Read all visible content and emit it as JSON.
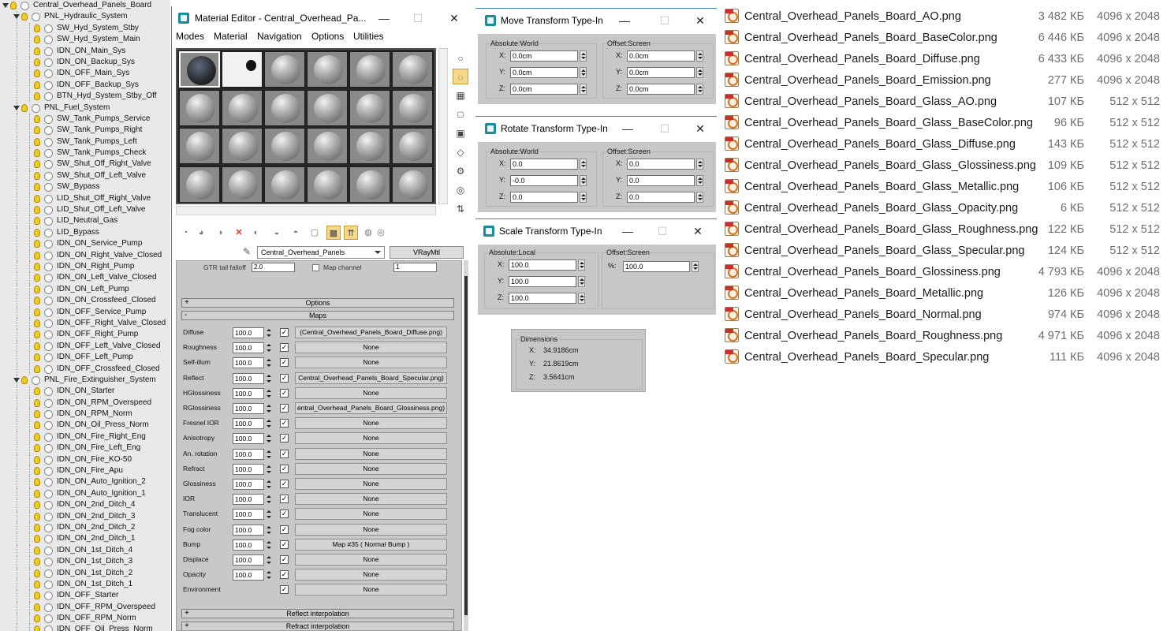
{
  "explorer": {
    "rows": [
      {
        "label": "Central_Overhead_Panels_Board",
        "depth": 0,
        "expandable": true
      },
      {
        "label": "PNL_Hydraulic_System",
        "depth": 1,
        "expandable": true
      },
      {
        "label": "SW_Hyd_System_Stby",
        "depth": 2,
        "expandable": false
      },
      {
        "label": "SW_Hyd_System_Main",
        "depth": 2,
        "expandable": false
      },
      {
        "label": "IDN_ON_Main_Sys",
        "depth": 2,
        "expandable": false
      },
      {
        "label": "IDN_ON_Backup_Sys",
        "depth": 2,
        "expandable": false
      },
      {
        "label": "IDN_OFF_Main_Sys",
        "depth": 2,
        "expandable": false
      },
      {
        "label": "IDN_OFF_Backup_Sys",
        "depth": 2,
        "expandable": false
      },
      {
        "label": "BTN_Hyd_System_Stby_Off",
        "depth": 2,
        "expandable": false
      },
      {
        "label": "PNL_Fuel_System",
        "depth": 1,
        "expandable": true
      },
      {
        "label": "SW_Tank_Pumps_Service",
        "depth": 2,
        "expandable": false
      },
      {
        "label": "SW_Tank_Pumps_Right",
        "depth": 2,
        "expandable": false
      },
      {
        "label": "SW_Tank_Pumps_Left",
        "depth": 2,
        "expandable": false
      },
      {
        "label": "SW_Tank_Pumps_Check",
        "depth": 2,
        "expandable": false
      },
      {
        "label": "SW_Shut_Off_Right_Valve",
        "depth": 2,
        "expandable": false
      },
      {
        "label": "SW_Shut_Off_Left_Valve",
        "depth": 2,
        "expandable": false
      },
      {
        "label": "SW_Bypass",
        "depth": 2,
        "expandable": false
      },
      {
        "label": "LID_Shut_Off_Right_Valve",
        "depth": 2,
        "expandable": false
      },
      {
        "label": "LID_Shut_Off_Left_Valve",
        "depth": 2,
        "expandable": false
      },
      {
        "label": "LID_Neutral_Gas",
        "depth": 2,
        "expandable": false
      },
      {
        "label": "LID_Bypass",
        "depth": 2,
        "expandable": false
      },
      {
        "label": "IDN_ON_Service_Pump",
        "depth": 2,
        "expandable": false
      },
      {
        "label": "IDN_ON_Right_Valve_Closed",
        "depth": 2,
        "expandable": false
      },
      {
        "label": "IDN_ON_Right_Pump",
        "depth": 2,
        "expandable": false
      },
      {
        "label": "IDN_ON_Left_Valve_Closed",
        "depth": 2,
        "expandable": false
      },
      {
        "label": "IDN_ON_Left_Pump",
        "depth": 2,
        "expandable": false
      },
      {
        "label": "IDN_ON_Crossfeed_Closed",
        "depth": 2,
        "expandable": false
      },
      {
        "label": "IDN_OFF_Service_Pump",
        "depth": 2,
        "expandable": false
      },
      {
        "label": "IDN_OFF_Right_Valve_Closed",
        "depth": 2,
        "expandable": false
      },
      {
        "label": "IDN_OFF_Right_Pump",
        "depth": 2,
        "expandable": false
      },
      {
        "label": "IDN_OFF_Left_Valve_Closed",
        "depth": 2,
        "expandable": false
      },
      {
        "label": "IDN_OFF_Left_Pump",
        "depth": 2,
        "expandable": false
      },
      {
        "label": "IDN_OFF_Crossfeed_Closed",
        "depth": 2,
        "expandable": false
      },
      {
        "label": "PNL_Fire_Extinguisher_System",
        "depth": 1,
        "expandable": true
      },
      {
        "label": "IDN_ON_Starter",
        "depth": 2,
        "expandable": false
      },
      {
        "label": "IDN_ON_RPM_Overspeed",
        "depth": 2,
        "expandable": false
      },
      {
        "label": "IDN_ON_RPM_Norm",
        "depth": 2,
        "expandable": false
      },
      {
        "label": "IDN_ON_Oil_Press_Norm",
        "depth": 2,
        "expandable": false
      },
      {
        "label": "IDN_ON_Fire_Right_Eng",
        "depth": 2,
        "expandable": false
      },
      {
        "label": "IDN_ON_Fire_Left_Eng",
        "depth": 2,
        "expandable": false
      },
      {
        "label": "IDN_ON_Fire_KO-50",
        "depth": 2,
        "expandable": false
      },
      {
        "label": "IDN_ON_Fire_Apu",
        "depth": 2,
        "expandable": false
      },
      {
        "label": "IDN_ON_Auto_Ignition_2",
        "depth": 2,
        "expandable": false
      },
      {
        "label": "IDN_ON_Auto_Ignition_1",
        "depth": 2,
        "expandable": false
      },
      {
        "label": "IDN_ON_2nd_Ditch_4",
        "depth": 2,
        "expandable": false
      },
      {
        "label": "IDN_ON_2nd_Ditch_3",
        "depth": 2,
        "expandable": false
      },
      {
        "label": "IDN_ON_2nd_Ditch_2",
        "depth": 2,
        "expandable": false
      },
      {
        "label": "IDN_ON_2nd_Ditch_1",
        "depth": 2,
        "expandable": false
      },
      {
        "label": "IDN_ON_1st_Ditch_4",
        "depth": 2,
        "expandable": false
      },
      {
        "label": "IDN_ON_1st_Ditch_3",
        "depth": 2,
        "expandable": false
      },
      {
        "label": "IDN_ON_1st_Ditch_2",
        "depth": 2,
        "expandable": false
      },
      {
        "label": "IDN_ON_1st_Ditch_1",
        "depth": 2,
        "expandable": false
      },
      {
        "label": "IDN_OFF_Starter",
        "depth": 2,
        "expandable": false
      },
      {
        "label": "IDN_OFF_RPM_Overspeed",
        "depth": 2,
        "expandable": false
      },
      {
        "label": "IDN_OFF_RPM_Norm",
        "depth": 2,
        "expandable": false
      },
      {
        "label": "IDN_OFF_Oil_Press_Norm",
        "depth": 2,
        "expandable": false
      }
    ]
  },
  "material_editor": {
    "title": "Material Editor - Central_Overhead_Pa...",
    "menu": [
      "Modes",
      "Material",
      "Navigation",
      "Options",
      "Utilities"
    ],
    "material_name": "Central_Overhead_Panels",
    "material_type": "VRayMtl",
    "partial_row": {
      "label": "GTR tail falloff",
      "value": "2.0",
      "checkbox_label": "Map channel",
      "channel": "1"
    },
    "rollouts": {
      "options": {
        "sign": "+",
        "label": "Options"
      },
      "maps": {
        "sign": "-",
        "label": "Maps"
      },
      "reflect_interp": {
        "sign": "+",
        "label": "Reflect interpolation"
      },
      "refract_interp": {
        "sign": "+",
        "label": "Refract interpolation"
      }
    },
    "maps": [
      {
        "name": "Diffuse",
        "amount": "100.0",
        "checked": true,
        "map": "(Central_Overhead_Panels_Board_Diffuse.png)"
      },
      {
        "name": "Roughness",
        "amount": "100.0",
        "checked": true,
        "map": "None"
      },
      {
        "name": "Self-illum",
        "amount": "100.0",
        "checked": true,
        "map": "None"
      },
      {
        "name": "Reflect",
        "amount": "100.0",
        "checked": true,
        "map": "Central_Overhead_Panels_Board_Specular.png)"
      },
      {
        "name": "HGlossiness",
        "amount": "100.0",
        "checked": true,
        "map": "None"
      },
      {
        "name": "RGlossiness",
        "amount": "100.0",
        "checked": true,
        "map": "entral_Overhead_Panels_Board_Glossiness.png)"
      },
      {
        "name": "Fresnel IOR",
        "amount": "100.0",
        "checked": true,
        "map": "None"
      },
      {
        "name": "Anisotropy",
        "amount": "100.0",
        "checked": true,
        "map": "None"
      },
      {
        "name": "An. rotation",
        "amount": "100.0",
        "checked": true,
        "map": "None"
      },
      {
        "name": "Refract",
        "amount": "100.0",
        "checked": true,
        "map": "None"
      },
      {
        "name": "Glossiness",
        "amount": "100.0",
        "checked": true,
        "map": "None"
      },
      {
        "name": "IOR",
        "amount": "100.0",
        "checked": true,
        "map": "None"
      },
      {
        "name": "Translucent",
        "amount": "100.0",
        "checked": true,
        "map": "None"
      },
      {
        "name": "Fog color",
        "amount": "100.0",
        "checked": true,
        "map": "None"
      },
      {
        "name": "Bump",
        "amount": "100.0",
        "checked": true,
        "map": "Map #35  ( Normal Bump )"
      },
      {
        "name": "Displace",
        "amount": "100.0",
        "checked": true,
        "map": "None"
      },
      {
        "name": "Opacity",
        "amount": "100.0",
        "checked": true,
        "map": "None"
      },
      {
        "name": "Environment",
        "amount": "",
        "checked": true,
        "map": "None"
      }
    ],
    "check_glyph": "✓",
    "colors": {
      "title_border": "#3c7ed6",
      "panel_bg": "#c8c8c8",
      "slot_bg": "#262626",
      "active_tool": "#f7d88a"
    }
  },
  "move_dialog": {
    "title": "Move Transform Type-In",
    "left_group": "Absolute:World",
    "right_group": "Offset:Screen",
    "left": [
      {
        "axis": "X:",
        "value": "0.0cm"
      },
      {
        "axis": "Y:",
        "value": "0.0cm"
      },
      {
        "axis": "Z:",
        "value": "0.0cm"
      }
    ],
    "right": [
      {
        "axis": "X:",
        "value": "0.0cm"
      },
      {
        "axis": "Y:",
        "value": "0.0cm"
      },
      {
        "axis": "Z:",
        "value": "0.0cm"
      }
    ]
  },
  "rotate_dialog": {
    "title": "Rotate Transform Type-In",
    "left_group": "Absolute:World",
    "right_group": "Offset:Screen",
    "left": [
      {
        "axis": "X:",
        "value": "0.0"
      },
      {
        "axis": "Y:",
        "value": "-0.0"
      },
      {
        "axis": "Z:",
        "value": "0.0"
      }
    ],
    "right": [
      {
        "axis": "X:",
        "value": "0.0"
      },
      {
        "axis": "Y:",
        "value": "0.0"
      },
      {
        "axis": "Z:",
        "value": "0.0"
      }
    ]
  },
  "scale_dialog": {
    "title": "Scale Transform Type-In",
    "left_group": "Absolute:Local",
    "right_group": "Offset:Screen",
    "left": [
      {
        "axis": "X:",
        "value": "100.0"
      },
      {
        "axis": "Y:",
        "value": "100.0"
      },
      {
        "axis": "Z:",
        "value": "100.0"
      }
    ],
    "right": [
      {
        "axis": "%:",
        "value": "100.0"
      }
    ]
  },
  "dimensions": {
    "title": "Dimensions",
    "rows": [
      {
        "axis": "X:",
        "value": "34.9186cm"
      },
      {
        "axis": "Y:",
        "value": "21.8619cm"
      },
      {
        "axis": "Z:",
        "value": "3.5641cm"
      }
    ]
  },
  "window_buttons": {
    "minimize": "—",
    "maximize": "☐",
    "close": "✕"
  },
  "files": [
    {
      "name": "Central_Overhead_Panels_Board_AO.png",
      "size": "3 482 КБ",
      "dims": "4096 x 2048"
    },
    {
      "name": "Central_Overhead_Panels_Board_BaseColor.png",
      "size": "6 446 КБ",
      "dims": "4096 x 2048"
    },
    {
      "name": "Central_Overhead_Panels_Board_Diffuse.png",
      "size": "6 433 КБ",
      "dims": "4096 x 2048"
    },
    {
      "name": "Central_Overhead_Panels_Board_Emission.png",
      "size": "277 КБ",
      "dims": "4096 x 2048"
    },
    {
      "name": "Central_Overhead_Panels_Board_Glass_AO.png",
      "size": "107 КБ",
      "dims": "512 x 512"
    },
    {
      "name": "Central_Overhead_Panels_Board_Glass_BaseColor.png",
      "size": "96 КБ",
      "dims": "512 x 512"
    },
    {
      "name": "Central_Overhead_Panels_Board_Glass_Diffuse.png",
      "size": "143 КБ",
      "dims": "512 x 512"
    },
    {
      "name": "Central_Overhead_Panels_Board_Glass_Glossiness.png",
      "size": "109 КБ",
      "dims": "512 x 512"
    },
    {
      "name": "Central_Overhead_Panels_Board_Glass_Metallic.png",
      "size": "106 КБ",
      "dims": "512 x 512"
    },
    {
      "name": "Central_Overhead_Panels_Board_Glass_Opacity.png",
      "size": "6 КБ",
      "dims": "512 x 512"
    },
    {
      "name": "Central_Overhead_Panels_Board_Glass_Roughness.png",
      "size": "122 КБ",
      "dims": "512 x 512"
    },
    {
      "name": "Central_Overhead_Panels_Board_Glass_Specular.png",
      "size": "124 КБ",
      "dims": "512 x 512"
    },
    {
      "name": "Central_Overhead_Panels_Board_Glossiness.png",
      "size": "4 793 КБ",
      "dims": "4096 x 2048"
    },
    {
      "name": "Central_Overhead_Panels_Board_Metallic.png",
      "size": "126 КБ",
      "dims": "4096 x 2048"
    },
    {
      "name": "Central_Overhead_Panels_Board_Normal.png",
      "size": "974 КБ",
      "dims": "4096 x 2048"
    },
    {
      "name": "Central_Overhead_Panels_Board_Roughness.png",
      "size": "4 971 КБ",
      "dims": "4096 x 2048"
    },
    {
      "name": "Central_Overhead_Panels_Board_Specular.png",
      "size": "111 КБ",
      "dims": "4096 x 2048"
    }
  ]
}
